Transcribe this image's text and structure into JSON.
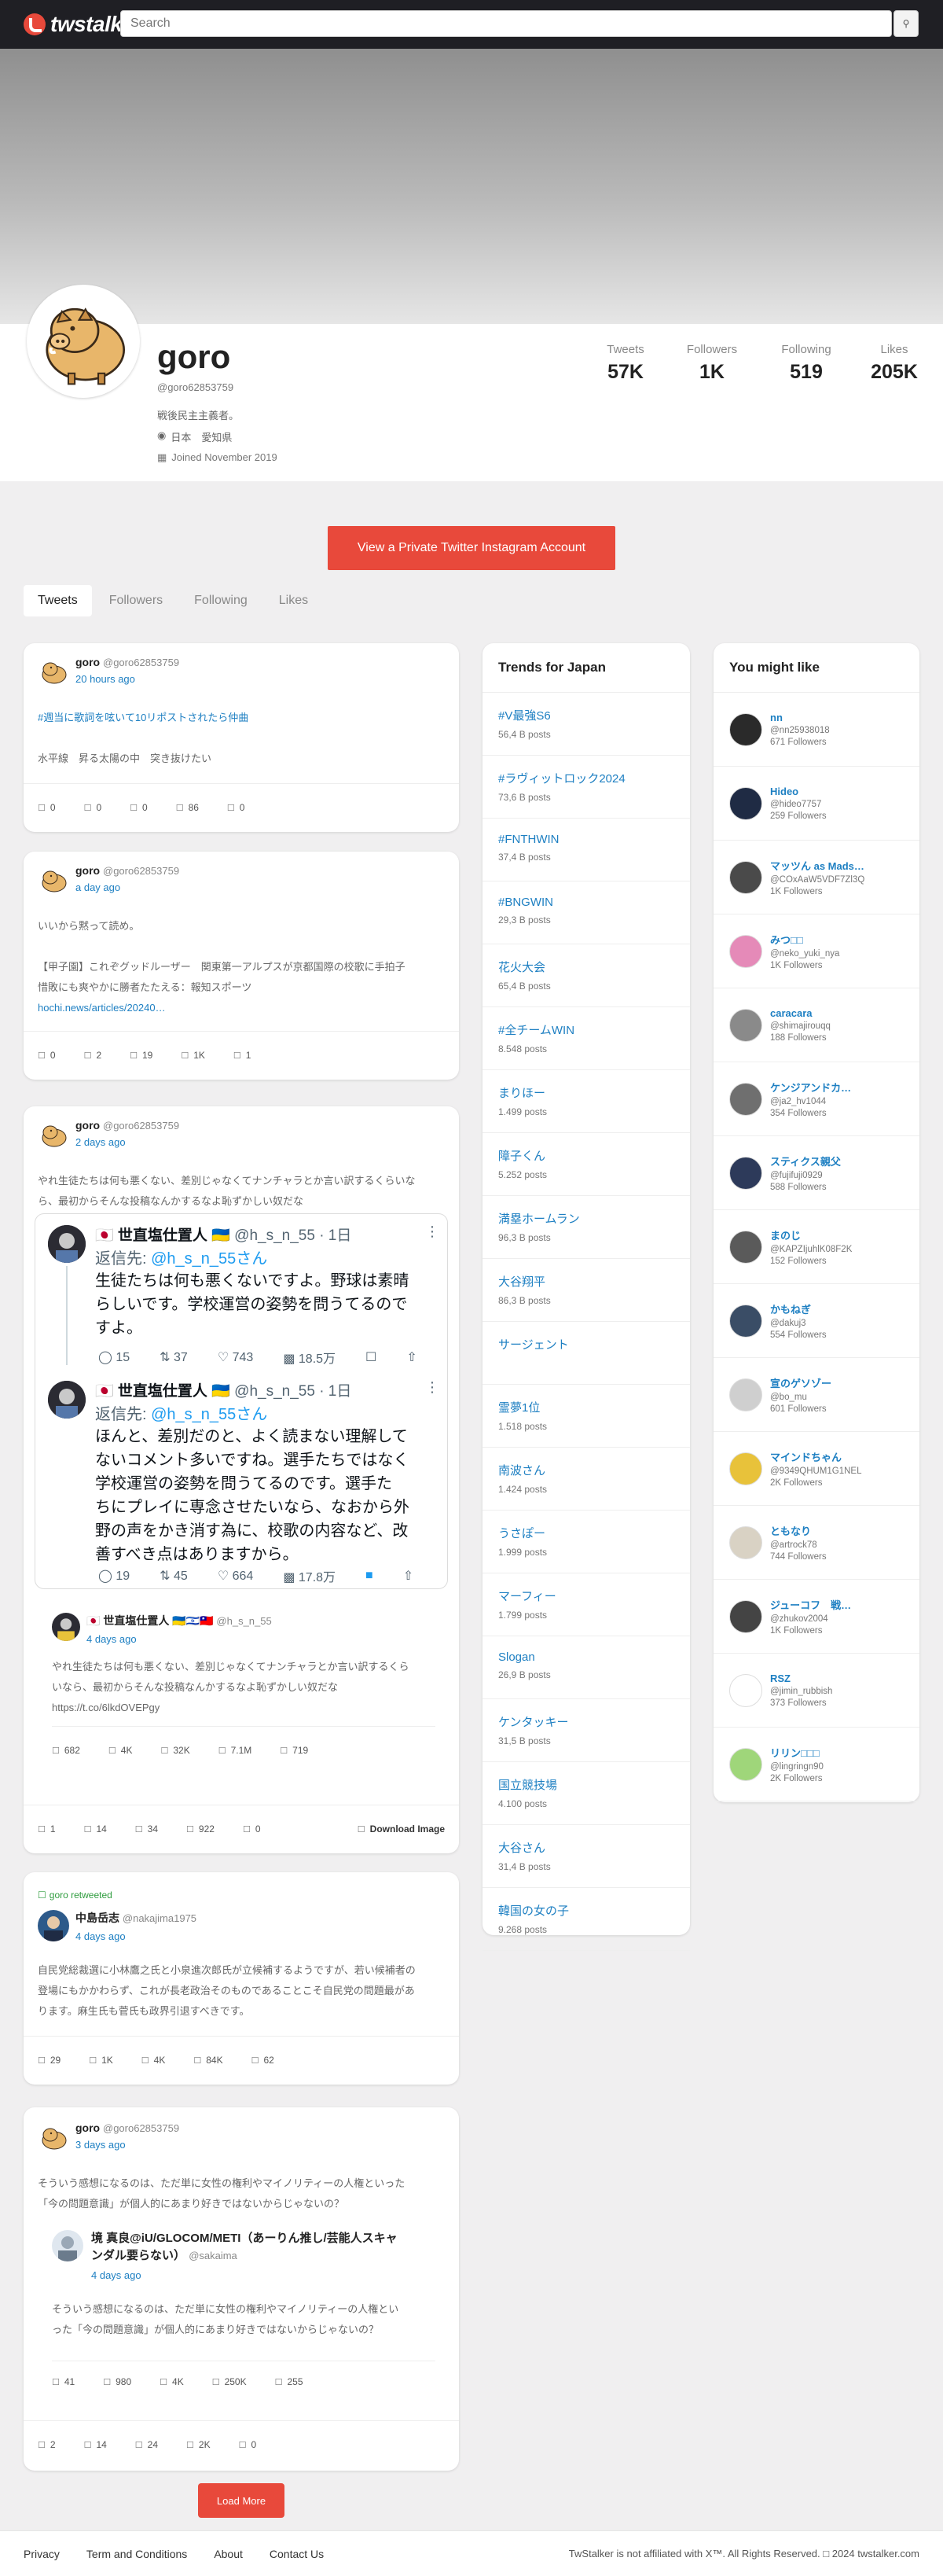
{
  "brand": {
    "name": "twstalker"
  },
  "search": {
    "placeholder": "Search",
    "button_icon": "search-icon"
  },
  "profile": {
    "name": "goro",
    "handle": "@goro62853759",
    "bio": "戦後民主主義者。",
    "location": "日本　愛知県",
    "joined": "Joined November 2019",
    "stats": [
      {
        "label": "Tweets",
        "value": "57K"
      },
      {
        "label": "Followers",
        "value": "1K"
      },
      {
        "label": "Following",
        "value": "519"
      },
      {
        "label": "Likes",
        "value": "205K"
      }
    ]
  },
  "cta": {
    "label": "View a Private Twitter Instagram Account"
  },
  "tabs": [
    "Tweets",
    "Followers",
    "Following",
    "Likes"
  ],
  "tweets": [
    {
      "name": "goro",
      "handle": "@goro62853759",
      "time": "20 hours ago",
      "hashtag": "#週当に歌詞を呟いて10リポストされたら仲曲",
      "text": "水平線　昇る太陽の中　突き抜けたい",
      "actions": [
        "0",
        "0",
        "0",
        "86",
        "0"
      ]
    },
    {
      "name": "goro",
      "handle": "@goro62853759",
      "time": "a day ago",
      "text1": "いいから黙って読め。",
      "text2": "【甲子園】これぞグッドルーザー　関東第一アルプスが京都国際の校歌に手拍子",
      "text3": "惜敗にも爽やかに勝者たたえる：報知スポーツ",
      "link": "hochi.news/articles/20240…",
      "actions": [
        "0",
        "2",
        "19",
        "1K",
        "1"
      ]
    },
    {
      "name": "goro",
      "handle": "@goro62853759",
      "time": "2 days ago",
      "text1": "やれ生徒たちは何も悪くない、差別じゃなくてナンチャラとか言い訳するくらいな",
      "text2": "ら、最初からそんな投稿なんかするなよ恥ずかしい奴だな",
      "embed": {
        "first": {
          "name": "🇯🇵 世直塩仕置人 🇺🇦",
          "meta": "@h_s_n_55 · 1日",
          "reply_prefix": "返信先: ",
          "reply_to": "@h_s_n_55さん",
          "lines": [
            "生徒たちは何も悪くないですよ。野球は素晴",
            "らしいです。学校運営の姿勢を問うてるので",
            "すよ。"
          ],
          "stats": [
            "15",
            "37",
            "743",
            "18.5万"
          ]
        },
        "second": {
          "name": "🇯🇵 世直塩仕置人 🇺🇦",
          "meta": "@h_s_n_55 · 1日",
          "reply_prefix": "返信先: ",
          "reply_to": "@h_s_n_55さん",
          "lines": [
            "ほんと、差別だのと、よく読まない理解して",
            "ないコメント多いですね。選手たちではなく",
            "学校運営の姿勢を問うてるのです。選手た",
            "ちにプレイに専念させたいなら、なおから外",
            "野の声をかき消す為に、校歌の内容など、改",
            "善すべき点はありますから。"
          ],
          "stats": [
            "19",
            "45",
            "664",
            "17.8万"
          ]
        }
      },
      "quoted": {
        "name": "🇯🇵 世直塩仕置人 🇺🇦🇮🇱🇹🇼",
        "handle": "@h_s_n_55",
        "time": "4 days ago",
        "text1": "やれ生徒たちは何も悪くない、差別じゃなくてナンチャラとか言い訳するくら",
        "text2": "いなら、最初からそんな投稿なんかするなよ恥ずかしい奴だな",
        "link": "https://t.co/6lkdOVEPgy",
        "actions": [
          "682",
          "4K",
          "32K",
          "7.1M",
          "719"
        ]
      },
      "actions": [
        "1",
        "14",
        "34",
        "922",
        "0"
      ],
      "download": "Download Image"
    },
    {
      "retweeted": "goro retweeted",
      "name": "中島岳志",
      "handle": "@nakajima1975",
      "time": "4 days ago",
      "text1": "自民党総裁選に小林鷹之氏と小泉進次郎氏が立候補するようですが、若い候補者の",
      "text2": "登場にもかかわらず、これが長老政治そのものであることこそ自民党の問題最があ",
      "text3": "ります。麻生氏も菅氏も政界引退すべきです。",
      "actions": [
        "29",
        "1K",
        "4K",
        "84K",
        "62"
      ]
    },
    {
      "name": "goro",
      "handle": "@goro62853759",
      "time": "3 days ago",
      "text1": "そういう感想になるのは、ただ単に女性の権利やマイノリティーの人権といった",
      "text2": "「今の問題意識」が個人的にあまり好きではないからじゃないの？",
      "quoted": {
        "name_line1": "境 真良@iU/GLOCOM/METI（あーりん推し/芸能人スキャ",
        "name_line2": "ンダル要らない）",
        "handle": "@sakaima",
        "time": "4 days ago",
        "text1": "そういう感想になるのは、ただ単に女性の権利やマイノリティーの人権とい",
        "text2": "った「今の問題意識」が個人的にあまり好きではないからじゃないの？",
        "actions": [
          "41",
          "980",
          "4K",
          "250K",
          "255"
        ]
      },
      "actions": [
        "2",
        "14",
        "24",
        "2K",
        "0"
      ]
    }
  ],
  "trends": {
    "title": "Trends for Japan",
    "items": [
      {
        "name": "#V最強S6",
        "count": "56,4 B posts"
      },
      {
        "name": "#ラヴィットロック2024",
        "count": "73,6 B posts"
      },
      {
        "name": "#FNTHWIN",
        "count": "37,4 B posts"
      },
      {
        "name": "#BNGWIN",
        "count": "29,3 B posts"
      },
      {
        "name": "花火大会",
        "count": "65,4 B posts"
      },
      {
        "name": "#全チームWIN",
        "count": "8.548 posts"
      },
      {
        "name": "まりほー",
        "count": "1.499 posts"
      },
      {
        "name": "障子くん",
        "count": "5.252 posts"
      },
      {
        "name": "満塁ホームラン",
        "count": "96,3 B posts"
      },
      {
        "name": "大谷翔平",
        "count": "86,3 B posts"
      },
      {
        "name": "サージェント",
        "count": ""
      },
      {
        "name": "霊夢1位",
        "count": "1.518 posts"
      },
      {
        "name": "南波さん",
        "count": "1.424 posts"
      },
      {
        "name": "うさぽー",
        "count": "1.999 posts"
      },
      {
        "name": "マーフィー",
        "count": "1.799 posts"
      },
      {
        "name": "Slogan",
        "count": "26,9 B posts"
      },
      {
        "name": "ケンタッキー",
        "count": "31,5 B posts"
      },
      {
        "name": "国立競技場",
        "count": "4.100 posts"
      },
      {
        "name": "大谷さん",
        "count": "31,4 B posts"
      },
      {
        "name": "韓国の女の子",
        "count": "9.268 posts"
      }
    ]
  },
  "suggestions": {
    "title": "You might like",
    "items": [
      {
        "name": "nn",
        "handle": "@nn25938018",
        "followers": "671 Followers",
        "color": "#2a2a2a"
      },
      {
        "name": "Hideo",
        "handle": "@hideo7757",
        "followers": "259 Followers",
        "color": "#1f2b44"
      },
      {
        "name": "マッツん as Madst…",
        "handle": "@COxAaW5VDF7Zl3Q",
        "followers": "1K Followers",
        "color": "#4a4a4a"
      },
      {
        "name": "みつ□□",
        "handle": "@neko_yuki_nya",
        "followers": "1K Followers",
        "color": "#e58ab8"
      },
      {
        "name": "caracara",
        "handle": "@shimajirouqq",
        "followers": "188 Followers",
        "color": "#8a8a8a"
      },
      {
        "name": "ケンジアンドカ…",
        "handle": "@ja2_hv1044",
        "followers": "354 Followers",
        "color": "#6f6f6f"
      },
      {
        "name": "スティクス親父",
        "handle": "@fujifuji0929",
        "followers": "588 Followers",
        "color": "#2d3a5a"
      },
      {
        "name": "まのじ",
        "handle": "@KAPZIjuhlK08F2K",
        "followers": "152 Followers",
        "color": "#5a5a5a"
      },
      {
        "name": "かもねぎ",
        "handle": "@dakuj3",
        "followers": "554 Followers",
        "color": "#3a4d66"
      },
      {
        "name": "宣のゲソゾー",
        "handle": "@bo_mu",
        "followers": "601 Followers",
        "color": "#cfcfcf"
      },
      {
        "name": "マインドちゃん",
        "handle": "@9349QHUM1G1NEL",
        "followers": "2K Followers",
        "color": "#e8c23a"
      },
      {
        "name": "ともなり",
        "handle": "@artrock78",
        "followers": "744 Followers",
        "color": "#d9d2c4"
      },
      {
        "name": "ジューコフ　戦…",
        "handle": "@zhukov2004",
        "followers": "1K Followers",
        "color": "#444"
      },
      {
        "name": "RSZ",
        "handle": "@jimin_rubbish",
        "followers": "373 Followers",
        "color": "#ffffff"
      },
      {
        "name": "リリン□□□",
        "handle": "@lingringn90",
        "followers": "2K Followers",
        "color": "#9fd67a"
      }
    ]
  },
  "load_more": "Load More",
  "footer": {
    "links": [
      "Privacy",
      "Term and Conditions",
      "About",
      "Contact Us"
    ],
    "copyright": "TwStalker is not affiliated with X™. All Rights Reserved. □ 2024 twstalker.com"
  },
  "colors": {
    "accent": "#e8493b",
    "link": "#1d7fc2",
    "topbar": "#1f1f24"
  }
}
